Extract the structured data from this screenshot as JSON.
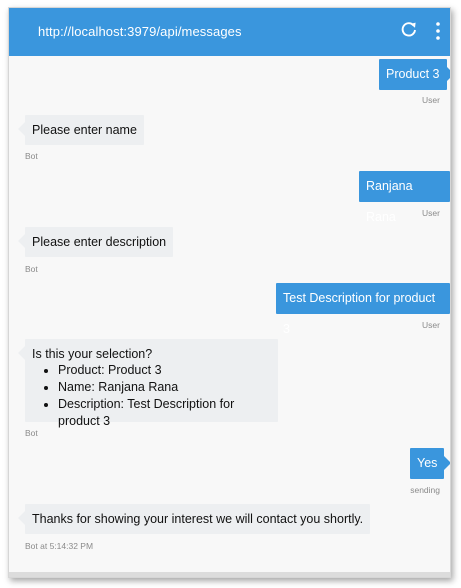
{
  "header": {
    "url": "http://localhost:3979/api/messages"
  },
  "messages": [
    {
      "from": "user",
      "text": "Product 3",
      "meta": "User"
    },
    {
      "from": "bot",
      "text": "Please enter name",
      "meta": "Bot"
    },
    {
      "from": "user",
      "text": "Ranjana Rana",
      "meta": "User"
    },
    {
      "from": "bot",
      "text": "Please enter description",
      "meta": "Bot"
    },
    {
      "from": "user",
      "text": "Test Description for product 3",
      "meta": "User"
    },
    {
      "from": "bot",
      "text": "Is this your selection?",
      "list": [
        "Product: Product 3",
        "Name: Ranjana Rana",
        "Description: Test Description for product 3"
      ],
      "meta": "Bot"
    },
    {
      "from": "user",
      "text": "Yes",
      "meta": "sending"
    },
    {
      "from": "bot",
      "text": "Thanks for showing your interest we will contact you shortly.",
      "meta": "Bot at 5:14:32 PM"
    }
  ],
  "icons": {
    "refresh": "refresh-icon",
    "menu": "more-vertical-icon"
  },
  "colors": {
    "accent": "#3a96dd",
    "bot_bubble": "#edeff1"
  }
}
